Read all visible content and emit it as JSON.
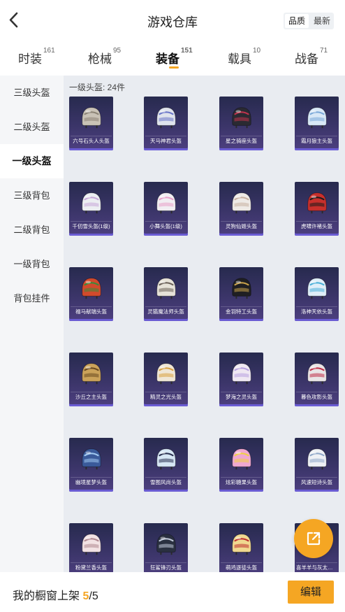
{
  "header": {
    "title": "游戏仓库",
    "back_icon": "chevron-left-icon"
  },
  "sort_toggle": {
    "options": [
      "品质",
      "最新"
    ],
    "selected": "品质"
  },
  "tabs": [
    {
      "label": "时装",
      "count": "161"
    },
    {
      "label": "枪械",
      "count": "95"
    },
    {
      "label": "装备",
      "count": "151",
      "active": true
    },
    {
      "label": "载具",
      "count": "10"
    },
    {
      "label": "战备",
      "count": "71"
    }
  ],
  "sidebar": {
    "items": [
      {
        "label": "三级头盔"
      },
      {
        "label": "二级头盔"
      },
      {
        "label": "一级头盔",
        "active": true
      },
      {
        "label": "三级背包"
      },
      {
        "label": "二级背包"
      },
      {
        "label": "一级背包"
      },
      {
        "label": "背包挂件"
      }
    ]
  },
  "section": {
    "label": "一级头盔: 24件"
  },
  "items": [
    {
      "name": "六号石头人头盔",
      "color": "#c9c2b6",
      "accent": "#8c8476"
    },
    {
      "name": "天马神君头盔",
      "color": "#dfe3ec",
      "accent": "#6a76c8"
    },
    {
      "name": "星之骑座头盔",
      "color": "#2a2a32",
      "accent": "#c0334d"
    },
    {
      "name": "霜月狼主头盔",
      "color": "#d8e8f6",
      "accent": "#7aa8d8"
    },
    {
      "name": "千仞雪头盔(1级)",
      "color": "#eceef2",
      "accent": "#c8a8d8"
    },
    {
      "name": "小舞头盔(1级)",
      "color": "#f1eef2",
      "accent": "#e8a0c8"
    },
    {
      "name": "灵狗仙姬头盔",
      "color": "#eeeae6",
      "accent": "#c8b0a0"
    },
    {
      "name": "虎啸许褚头盔",
      "color": "#c8302c",
      "accent": "#1c1c1c"
    },
    {
      "name": "福马献瑞头盔",
      "color": "#d24a2c",
      "accent": "#3a8a3a"
    },
    {
      "name": "灵猫魔法师头盔",
      "color": "#e6e2d8",
      "accent": "#6a6058"
    },
    {
      "name": "金羽特工头盔",
      "color": "#1f1f22",
      "accent": "#c9a24a"
    },
    {
      "name": "洛神天依头盔",
      "color": "#dfeef8",
      "accent": "#4ab0d8"
    },
    {
      "name": "沙丘之主头盔",
      "color": "#caa25a",
      "accent": "#6a4a20"
    },
    {
      "name": "精灵之光头盔",
      "color": "#efe6d6",
      "accent": "#d8a040"
    },
    {
      "name": "梦海之灵头盔",
      "color": "#efe8f2",
      "accent": "#b8a0e0"
    },
    {
      "name": "暮色攻影头盔",
      "color": "#e8e4e6",
      "accent": "#c03048"
    },
    {
      "name": "幽境星梦头盔",
      "color": "#3a5a9a",
      "accent": "#a0c8f0"
    },
    {
      "name": "雪图风尚头盔",
      "color": "#d6e6f4",
      "accent": "#2a3050"
    },
    {
      "name": "炫彩糖果头盔",
      "color": "#f0a8d0",
      "accent": "#f0d040"
    },
    {
      "name": "风速短诗头盔",
      "color": "#eef0f4",
      "accent": "#90a8c8"
    },
    {
      "name": "粉黛兰香头盔",
      "color": "#f2e2e4",
      "accent": "#b08890"
    },
    {
      "name": "狂鲨锋刃头盔",
      "color": "#2a3040",
      "accent": "#c0c8d8"
    },
    {
      "name": "萌鸡逐徒头盔",
      "color": "#f0d890",
      "accent": "#c03030"
    },
    {
      "name": "喜羊羊与灰太狼头盔",
      "color": "#f4eee6",
      "accent": "#d0a070"
    }
  ],
  "fab": {
    "icon": "share-external-icon"
  },
  "footer": {
    "shelf_label": "我的橱窗上架",
    "shelf_count": "5",
    "shelf_total": "/5",
    "edit_label": "编辑"
  },
  "colors": {
    "accent": "#f5a623",
    "card_bg": "#3b3569",
    "card_border": "#6a5cd3"
  }
}
